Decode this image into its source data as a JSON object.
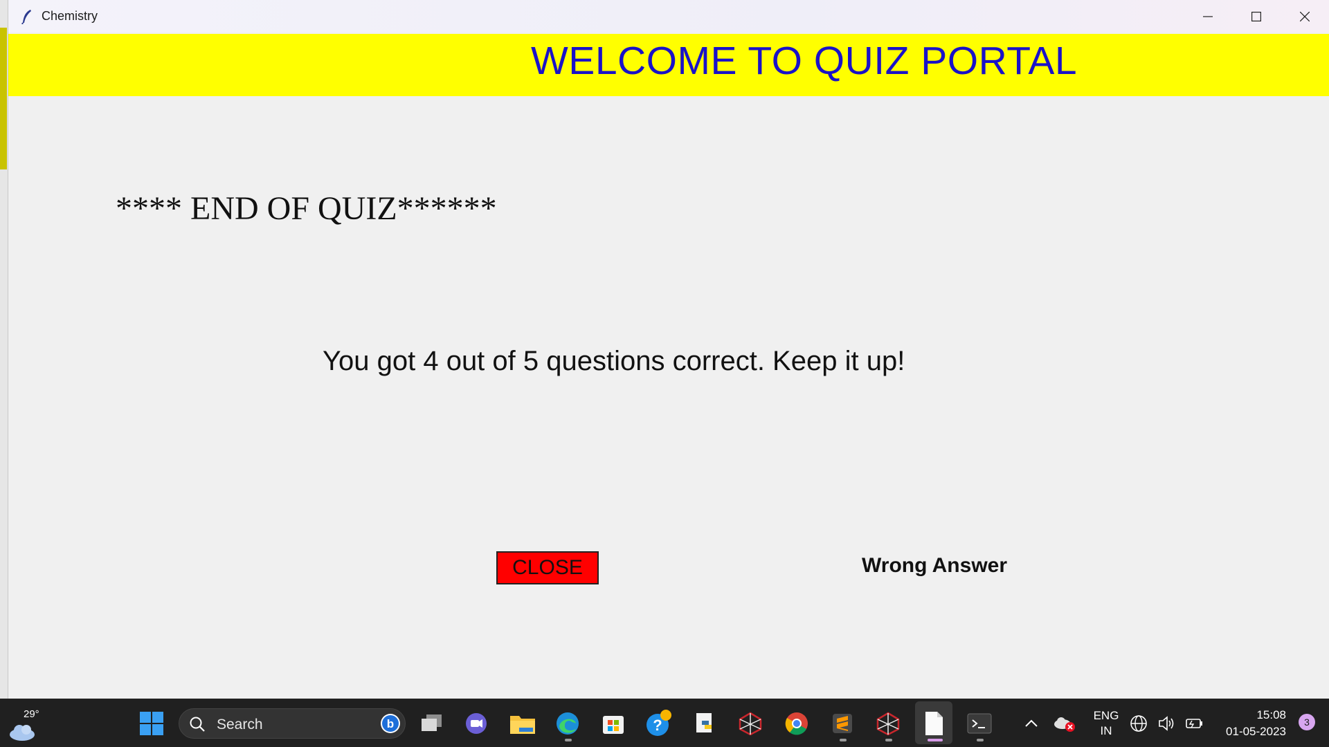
{
  "window": {
    "title": "Chemistry"
  },
  "banner": {
    "title": "WELCOME TO QUIZ PORTAL"
  },
  "quiz": {
    "end_title": "**** END OF QUIZ******",
    "result_text": "You got 4 out of 5 questions correct. Keep it up!",
    "close_label": "CLOSE",
    "feedback_text": "Wrong Answer"
  },
  "colors": {
    "banner_bg": "#ffff00",
    "banner_text": "#1a12c8",
    "close_button_bg": "#ff0000",
    "window_bg": "#f0f0f0"
  },
  "taskbar": {
    "weather_temp": "29°",
    "search_placeholder": "Search",
    "language_line1": "ENG",
    "language_line2": "IN",
    "time": "15:08",
    "date": "01-05-2023",
    "notification_count": "3",
    "pinned_apps": [
      "start-icon",
      "task-view-icon",
      "chat-icon",
      "file-explorer-icon",
      "edge-icon",
      "store-icon",
      "help-icon",
      "python-idle-icon",
      "network-app-icon",
      "chrome-icon",
      "sublime-text-icon",
      "network-app-icon",
      "blank-file-icon",
      "terminal-icon"
    ]
  }
}
